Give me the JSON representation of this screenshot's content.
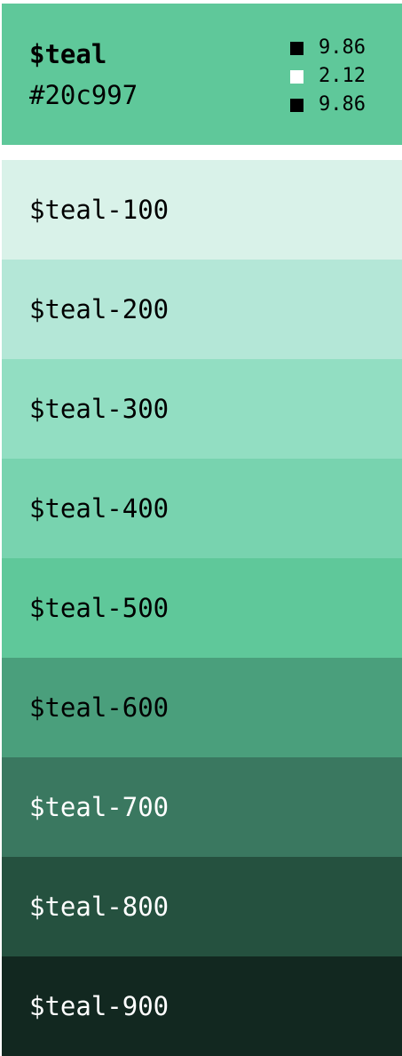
{
  "header": {
    "name": "$teal",
    "hex": "#20c997",
    "contrast": [
      {
        "value": "9.86",
        "swatch_color": "#000000"
      },
      {
        "value": "2.12",
        "swatch_color": "#ffffff"
      },
      {
        "value": "9.86",
        "swatch_color": "#000000"
      }
    ]
  },
  "shades": [
    {
      "label": "$teal-100",
      "bg": "#d9f2e9",
      "fg": "#000000"
    },
    {
      "label": "$teal-200",
      "bg": "#b4e7d7",
      "fg": "#000000"
    },
    {
      "label": "$teal-300",
      "bg": "#92dec2",
      "fg": "#000000"
    },
    {
      "label": "$teal-400",
      "bg": "#78d3af",
      "fg": "#000000"
    },
    {
      "label": "$teal-500",
      "bg": "#5fc89a",
      "fg": "#000000"
    },
    {
      "label": "$teal-600",
      "bg": "#4a9f7c",
      "fg": "#000000"
    },
    {
      "label": "$teal-700",
      "bg": "#3a7860",
      "fg": "#ffffff"
    },
    {
      "label": "$teal-800",
      "bg": "#25513f",
      "fg": "#ffffff"
    },
    {
      "label": "$teal-900",
      "bg": "#122820",
      "fg": "#ffffff"
    }
  ]
}
